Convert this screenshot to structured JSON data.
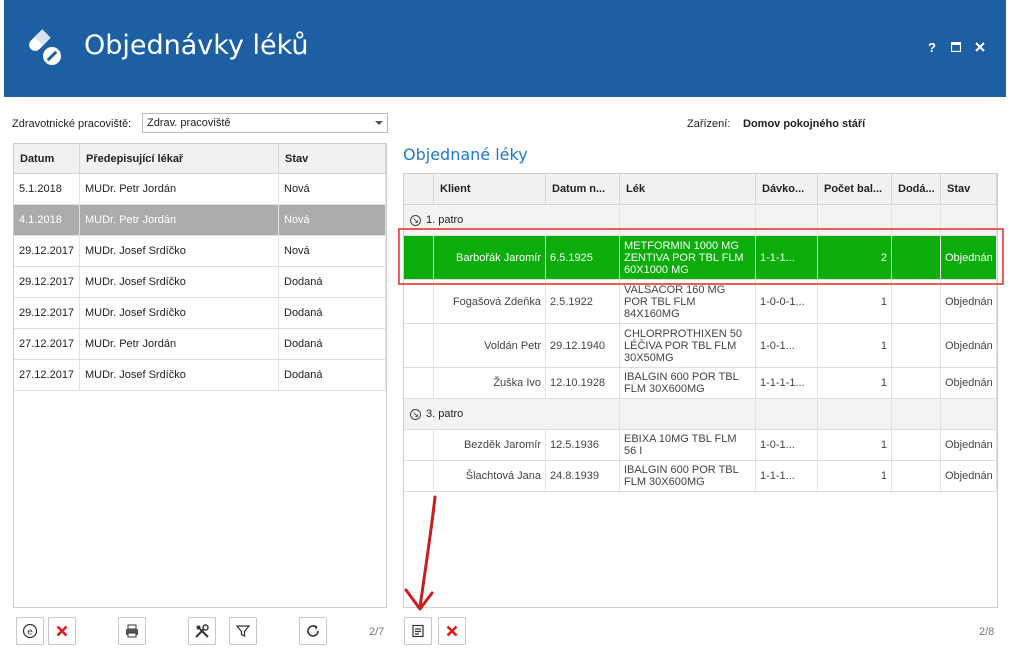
{
  "app": {
    "title": "Objednávky léků",
    "help": "?",
    "colors": {
      "header": "#1d5fa3",
      "accent": "#1e79c9",
      "highlight": "#0bad0b",
      "frame": "#ea5c5c"
    }
  },
  "filter": {
    "workplace_label": "Zdravotnické pracoviště:",
    "workplace_value": "Zdrav. pracoviště",
    "facility_label": "Zařízení:",
    "facility_value": "Domov pokojného stáří"
  },
  "prescriptions": {
    "columns": [
      "Datum",
      "Předepisující lékař",
      "Stav"
    ],
    "rows": [
      {
        "date": "5.1.2018",
        "doctor": "MUDr. Petr Jordán",
        "status": "Nová"
      },
      {
        "date": "4.1.2018",
        "doctor": "MUDr. Petr Jordán",
        "status": "Nová"
      },
      {
        "date": "29.12.2017",
        "doctor": "MUDr. Josef Srdíčko",
        "status": "Nová"
      },
      {
        "date": "29.12.2017",
        "doctor": "MUDr. Josef Srdíčko",
        "status": "Dodaná"
      },
      {
        "date": "29.12.2017",
        "doctor": "MUDr. Josef Srdíčko",
        "status": "Dodaná"
      },
      {
        "date": "27.12.2017",
        "doctor": "MUDr. Petr Jordán",
        "status": "Dodaná"
      },
      {
        "date": "27.12.2017",
        "doctor": "MUDr. Josef Srdíčko",
        "status": "Dodaná"
      }
    ],
    "selected_index": 1,
    "pager": "2/7"
  },
  "orders": {
    "title": "Objednané léky",
    "columns": [
      "Klient",
      "Datum n...",
      "Lék",
      "Dávko...",
      "Počet bal...",
      "Dodá...",
      "Stav"
    ],
    "groups": [
      {
        "label": "1. patro",
        "rows": [
          {
            "client": "Barbořák Jaromír",
            "birth": "6.5.1925",
            "drug": "METFORMIN 1000 MG ZENTIVA POR TBL FLM 60X1000 MG",
            "dose": "1-1-1...",
            "count": "2",
            "delivered": "",
            "status": "Objednán"
          },
          {
            "client": "Fogašová Zdeňka",
            "birth": "2.5.1922",
            "drug": "VALSACOR 160 MG POR TBL FLM 84X160MG",
            "dose": "1-0-0-1...",
            "count": "1",
            "delivered": "",
            "status": "Objednán"
          },
          {
            "client": "Voldán Petr",
            "birth": "29.12.1940",
            "drug": "CHLORPROTHIXEN 50 LÉČIVA POR TBL FLM 30X50MG",
            "dose": "1-0-1...",
            "count": "1",
            "delivered": "",
            "status": "Objednán"
          },
          {
            "client": "Žuška Ivo",
            "birth": "12.10.1928",
            "drug": "IBALGIN 600 POR TBL FLM 30X600MG",
            "dose": "1-1-1-1...",
            "count": "1",
            "delivered": "",
            "status": "Objednán"
          }
        ]
      },
      {
        "label": "3. patro",
        "rows": [
          {
            "client": "Bezděk Jaromír",
            "birth": "12.5.1936",
            "drug": "EBIXA 10MG TBL FLM 56 I",
            "dose": "1-0-1...",
            "count": "1",
            "delivered": "",
            "status": "Objednán"
          },
          {
            "client": "Šlachtová Jana",
            "birth": "24.8.1939",
            "drug": "IBALGIN 600 POR TBL FLM 30X600MG",
            "dose": "1-1-1...",
            "count": "1",
            "delivered": "",
            "status": "Objednán"
          }
        ]
      }
    ],
    "pager": "2/8"
  }
}
